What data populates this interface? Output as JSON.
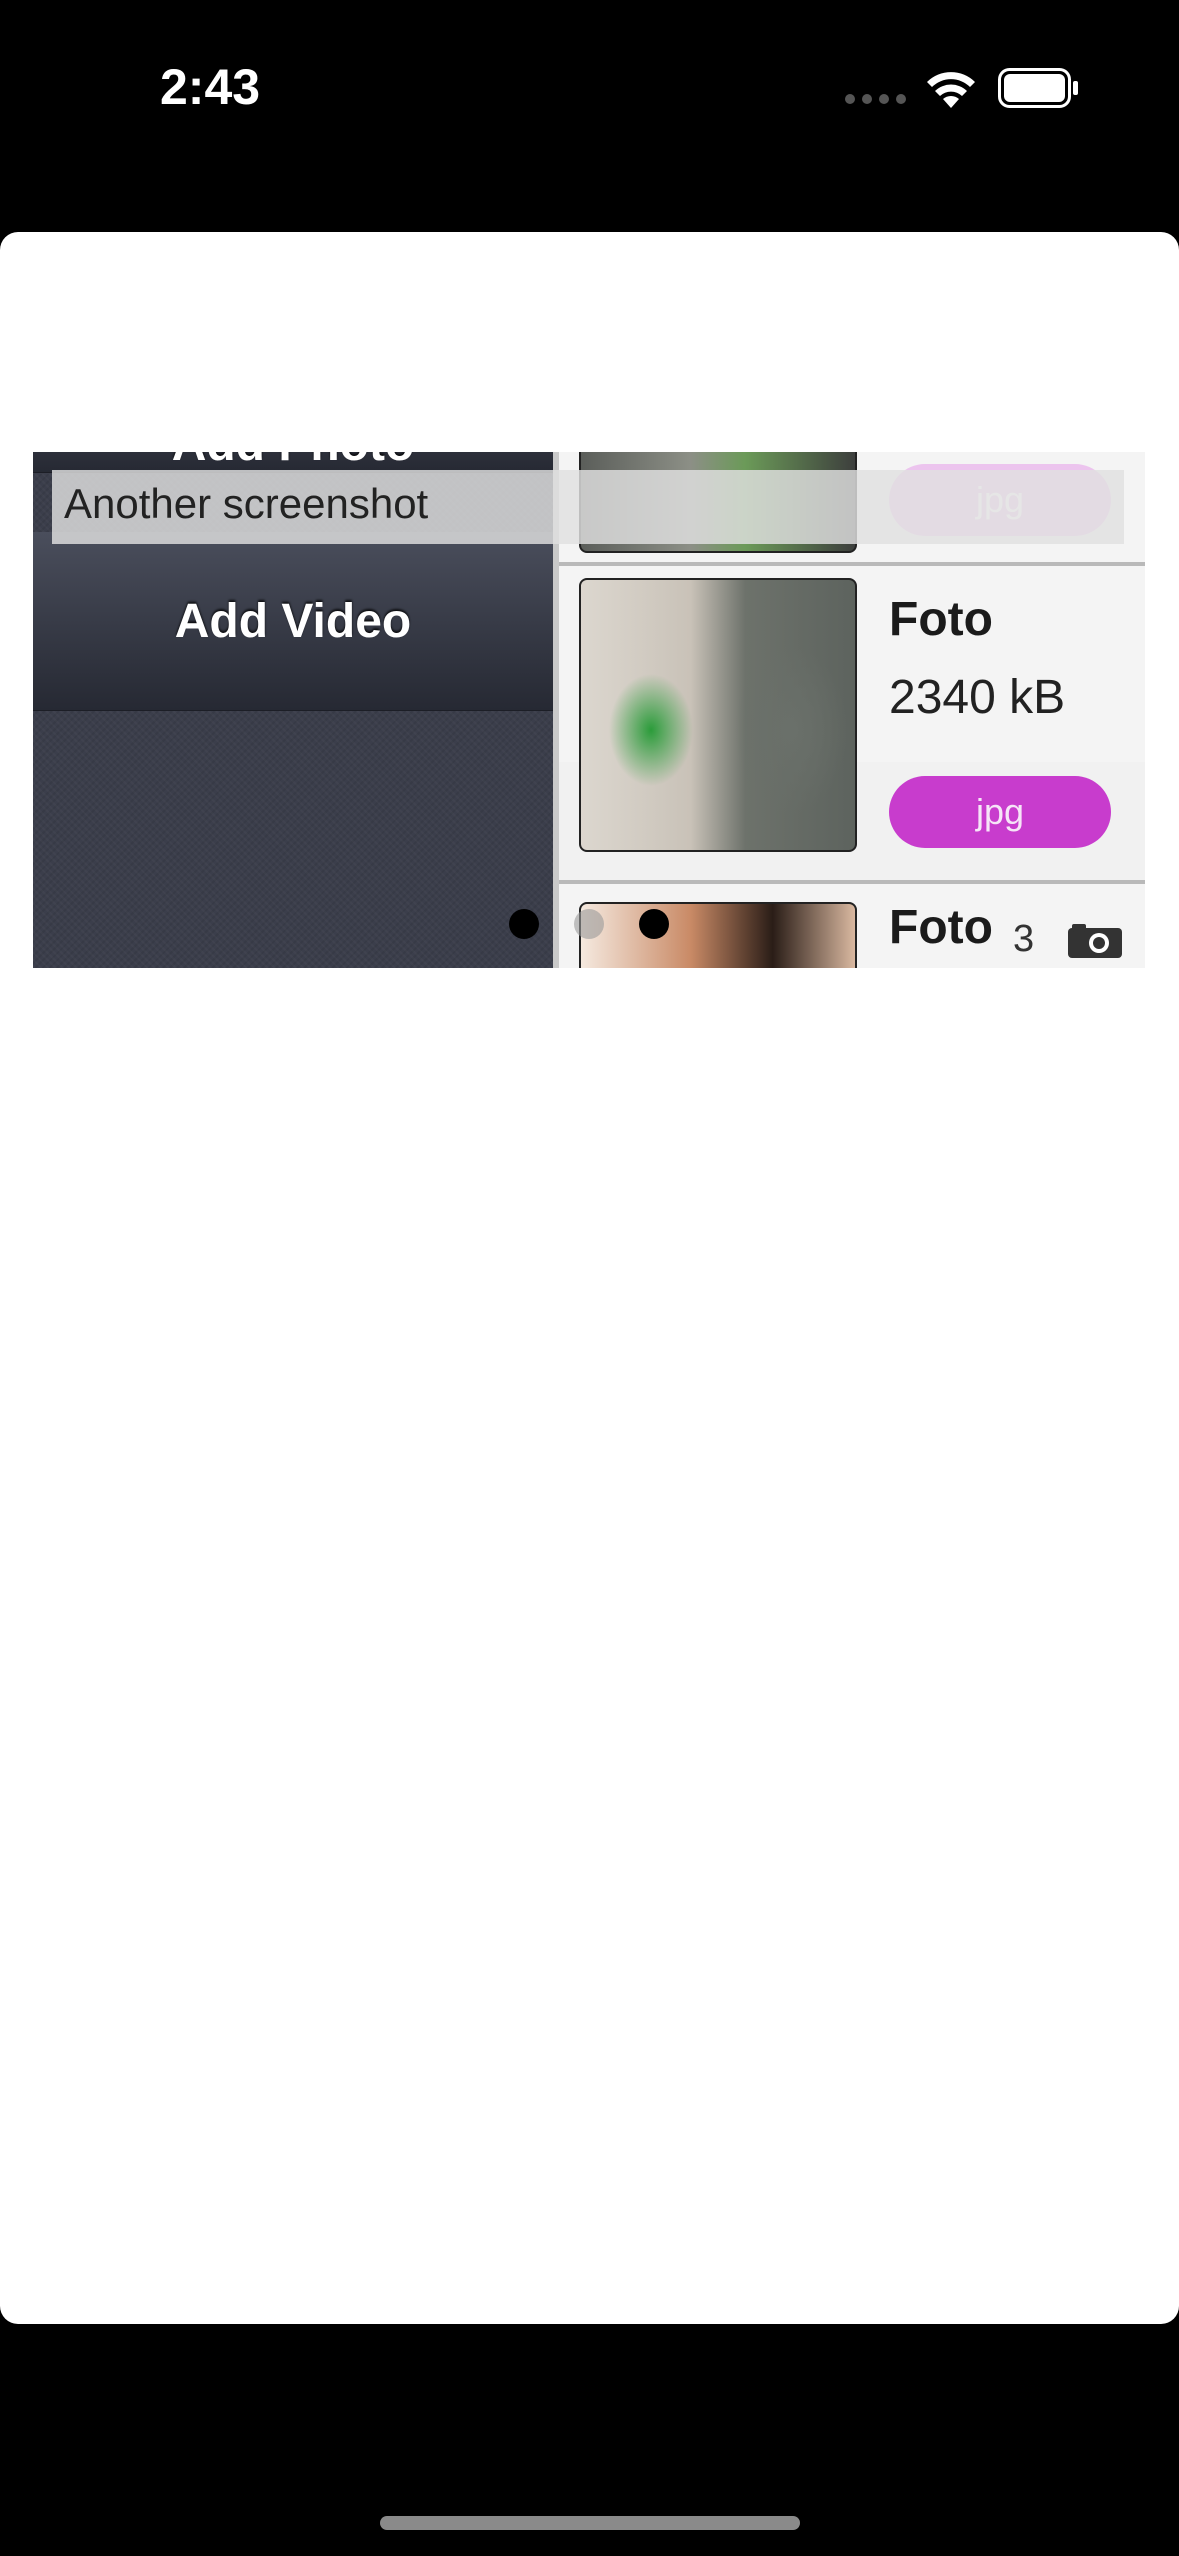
{
  "status_bar": {
    "time": "2:43"
  },
  "viewer": {
    "menu": {
      "add_photo_label": "Add Photo",
      "add_video_label": "Add Video"
    },
    "items": [
      {
        "title": "",
        "size": "",
        "type": "jpg"
      },
      {
        "title": "Foto",
        "size": "2340 kB",
        "type": "jpg"
      },
      {
        "title": "Foto",
        "size": "",
        "type": ""
      }
    ]
  },
  "caption": {
    "text": "Another screenshot"
  },
  "pager": {
    "total": 3,
    "current": 1
  },
  "counter": {
    "value": "3",
    "icon": "camera-icon"
  }
}
